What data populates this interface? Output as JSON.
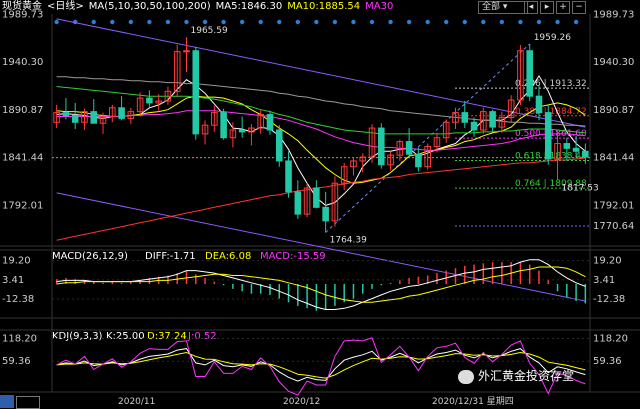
{
  "header": {
    "instrument": "现货黄金",
    "period": "<日线>",
    "ma_params": "MA(5,10,30,50,100,200)",
    "ma5": "MA5:1846.30",
    "ma10": "MA10:1885.54",
    "ma30": "MA30",
    "dropdown": "全部",
    "colors": {
      "ma5": "#ffffff",
      "ma10": "#ffff00",
      "ma30": "#ff33ff"
    }
  },
  "chart_data": [
    {
      "type": "candlestick",
      "ylim": [
        1750,
        1990
      ],
      "y_ticks": [
        "1989.73",
        "1940.30",
        "1890.87",
        "1841.44",
        "1792.01"
      ],
      "y_ticks_right": [
        "1989.73",
        "1940.30",
        "1890.87",
        "1841.44",
        "1792.01"
      ],
      "x_labels": [
        "2020/11",
        "2020/12",
        "2020/12/31 星期四"
      ],
      "current_price_line": 1841.44,
      "candles": [
        [
          1878,
          1896,
          1872,
          1888
        ],
        [
          1888,
          1903,
          1881,
          1885
        ],
        [
          1885,
          1898,
          1871,
          1878
        ],
        [
          1878,
          1892,
          1870,
          1889
        ],
        [
          1889,
          1902,
          1880,
          1877
        ],
        [
          1877,
          1888,
          1866,
          1884
        ],
        [
          1884,
          1896,
          1878,
          1893
        ],
        [
          1893,
          1905,
          1880,
          1882
        ],
        [
          1882,
          1893,
          1876,
          1889
        ],
        [
          1889,
          1909,
          1884,
          1903
        ],
        [
          1903,
          1911,
          1894,
          1898
        ],
        [
          1898,
          1907,
          1890,
          1900
        ],
        [
          1900,
          1915,
          1896,
          1910
        ],
        [
          1910,
          1958,
          1904,
          1951
        ],
        [
          1951,
          1966,
          1930,
          1952
        ],
        [
          1952,
          1956,
          1860,
          1866
        ],
        [
          1866,
          1880,
          1855,
          1875
        ],
        [
          1875,
          1895,
          1868,
          1888
        ],
        [
          1888,
          1892,
          1860,
          1862
        ],
        [
          1862,
          1878,
          1852,
          1870
        ],
        [
          1870,
          1884,
          1862,
          1868
        ],
        [
          1868,
          1876,
          1854,
          1872
        ],
        [
          1872,
          1891,
          1866,
          1886
        ],
        [
          1886,
          1890,
          1865,
          1870
        ],
        [
          1870,
          1875,
          1832,
          1838
        ],
        [
          1838,
          1848,
          1800,
          1806
        ],
        [
          1806,
          1818,
          1778,
          1783
        ],
        [
          1783,
          1815,
          1780,
          1810
        ],
        [
          1810,
          1818,
          1789,
          1790
        ],
        [
          1790,
          1806,
          1764,
          1776
        ],
        [
          1776,
          1822,
          1770,
          1815
        ],
        [
          1815,
          1836,
          1808,
          1832
        ],
        [
          1832,
          1842,
          1823,
          1838
        ],
        [
          1838,
          1846,
          1826,
          1842
        ],
        [
          1842,
          1876,
          1836,
          1872
        ],
        [
          1872,
          1877,
          1830,
          1834
        ],
        [
          1834,
          1848,
          1828,
          1844
        ],
        [
          1844,
          1860,
          1838,
          1858
        ],
        [
          1858,
          1872,
          1841,
          1845
        ],
        [
          1845,
          1852,
          1827,
          1832
        ],
        [
          1832,
          1856,
          1829,
          1853
        ],
        [
          1853,
          1867,
          1847,
          1862
        ],
        [
          1862,
          1881,
          1857,
          1878
        ],
        [
          1878,
          1893,
          1871,
          1888
        ],
        [
          1888,
          1900,
          1872,
          1878
        ],
        [
          1878,
          1883,
          1863,
          1870
        ],
        [
          1870,
          1893,
          1866,
          1889
        ],
        [
          1889,
          1891,
          1868,
          1873
        ],
        [
          1873,
          1889,
          1867,
          1883
        ],
        [
          1883,
          1906,
          1878,
          1901
        ],
        [
          1901,
          1958,
          1896,
          1952
        ],
        [
          1952,
          1959,
          1900,
          1905
        ],
        [
          1905,
          1916,
          1880,
          1888
        ],
        [
          1888,
          1896,
          1834,
          1840
        ],
        [
          1840,
          1870,
          1818,
          1856
        ],
        [
          1856,
          1862,
          1838,
          1851
        ],
        [
          1851,
          1864,
          1841,
          1848
        ],
        [
          1848,
          1856,
          1835,
          1842
        ]
      ],
      "ma_lines": [
        {
          "name": "MA5",
          "color": "#ffffff",
          "values": [
            1886,
            1887,
            1886,
            1885,
            1883,
            1882,
            1884,
            1884,
            1885,
            1886,
            1893,
            1896,
            1901,
            1912,
            1922,
            1916,
            1908,
            1897,
            1886,
            1872,
            1871,
            1868,
            1873,
            1871,
            1864,
            1850,
            1831,
            1815,
            1800,
            1792,
            1795,
            1804,
            1814,
            1832,
            1842,
            1848,
            1848,
            1850,
            1851,
            1843,
            1846,
            1850,
            1853,
            1856,
            1865,
            1871,
            1880,
            1880,
            1880,
            1886,
            1901,
            1911,
            1926,
            1910,
            1888,
            1868,
            1856,
            1848
          ]
        },
        {
          "name": "MA10",
          "color": "#ffff00",
          "values": [
            1890,
            1889,
            1889,
            1888,
            1886,
            1885,
            1884,
            1884,
            1885,
            1886,
            1888,
            1889,
            1891,
            1897,
            1903,
            1905,
            1904,
            1904,
            1903,
            1900,
            1897,
            1891,
            1886,
            1879,
            1872,
            1866,
            1859,
            1849,
            1840,
            1831,
            1824,
            1818,
            1815,
            1816,
            1818,
            1820,
            1826,
            1834,
            1843,
            1845,
            1848,
            1849,
            1852,
            1854,
            1858,
            1860,
            1864,
            1867,
            1869,
            1873,
            1882,
            1888,
            1894,
            1896,
            1898,
            1896,
            1892,
            1885
          ]
        },
        {
          "name": "MA30",
          "color": "#ff33ff",
          "values": [
            1884,
            1884,
            1884,
            1884,
            1884,
            1884,
            1884,
            1884,
            1885,
            1885,
            1886,
            1886,
            1887,
            1888,
            1890,
            1890,
            1890,
            1890,
            1889,
            1888,
            1887,
            1886,
            1885,
            1884,
            1882,
            1880,
            1877,
            1874,
            1871,
            1867,
            1863,
            1860,
            1857,
            1855,
            1853,
            1852,
            1852,
            1851,
            1851,
            1850,
            1849,
            1849,
            1850,
            1851,
            1852,
            1853,
            1854,
            1855,
            1856,
            1858,
            1861,
            1863,
            1865,
            1866,
            1866,
            1866,
            1865,
            1864
          ]
        },
        {
          "name": "MA50",
          "color": "#33cc33",
          "values": [
            1915,
            1914,
            1913,
            1912,
            1911,
            1910,
            1909,
            1908,
            1907,
            1906,
            1905,
            1905,
            1905,
            1905,
            1905,
            1904,
            1903,
            1902,
            1900,
            1898,
            1896,
            1894,
            1891,
            1889,
            1886,
            1884,
            1881,
            1878,
            1876,
            1874,
            1872,
            1870,
            1869,
            1868,
            1867,
            1866,
            1866,
            1866,
            1866,
            1866,
            1866,
            1866,
            1866,
            1867,
            1867,
            1867,
            1868,
            1868,
            1869,
            1869,
            1870,
            1871,
            1871,
            1871,
            1870,
            1869,
            1868,
            1867
          ]
        },
        {
          "name": "MA100",
          "color": "#999999",
          "values": [
            1925,
            1925,
            1924,
            1924,
            1923,
            1923,
            1922,
            1922,
            1921,
            1921,
            1920,
            1920,
            1919,
            1919,
            1918,
            1918,
            1917,
            1916,
            1915,
            1914,
            1913,
            1912,
            1911,
            1910,
            1908,
            1907,
            1905,
            1904,
            1902,
            1900,
            1899,
            1897,
            1896,
            1894,
            1893,
            1892,
            1890,
            1889,
            1888,
            1887,
            1886,
            1885,
            1884,
            1883,
            1882,
            1881,
            1880,
            1880,
            1879,
            1878,
            1878,
            1877,
            1877,
            1876,
            1876,
            1875,
            1875,
            1874
          ]
        },
        {
          "name": "MA200",
          "color": "#ff3333",
          "values": [
            1756,
            1758,
            1760,
            1762,
            1764,
            1766,
            1768,
            1770,
            1772,
            1774,
            1776,
            1778,
            1780,
            1782,
            1784,
            1786,
            1788,
            1790,
            1792,
            1794,
            1796,
            1798,
            1800,
            1802,
            1803,
            1805,
            1807,
            1808,
            1810,
            1811,
            1813,
            1814,
            1816,
            1817,
            1819,
            1820,
            1821,
            1822,
            1824,
            1825,
            1826,
            1827,
            1828,
            1829,
            1830,
            1831,
            1832,
            1833,
            1834,
            1835,
            1836,
            1836,
            1837,
            1838,
            1839,
            1839,
            1840,
            1841
          ]
        }
      ],
      "price_labels": [
        {
          "text": "1965.59",
          "i": 14,
          "price": 1966
        },
        {
          "text": "1764.39",
          "i": 29,
          "price": 1764
        },
        {
          "text": "1959.26",
          "i": 51,
          "price": 1959
        },
        {
          "text": "1817.53",
          "i": 54,
          "price": 1818
        }
      ],
      "fib_levels": [
        {
          "label": "0.236 | 1913.32",
          "price": 1913.32,
          "color": "#cccccc"
        },
        {
          "label": "0.382 | 1884.72",
          "price": 1884.72,
          "color": "#ff3333"
        },
        {
          "label": "0.500 | 1861.60",
          "price": 1861.6,
          "color": "#ff33ff"
        },
        {
          "label": "0.618 | 1838.48",
          "price": 1838.48,
          "color": "#33cc33"
        },
        {
          "label": "0.764 | 1809.88",
          "price": 1809.88,
          "color": "#33cc33"
        }
      ],
      "fib_extra_right": [
        "1770.64"
      ],
      "channel_upper": {
        "from": [
          0,
          1985
        ],
        "to": [
          57,
          1873
        ]
      },
      "channel_lower": {
        "from": [
          0,
          1805
        ],
        "to": [
          57,
          1693
        ]
      },
      "diag_line": {
        "from": [
          29,
          1764
        ],
        "to": [
          51,
          1959
        ]
      }
    },
    {
      "type": "bar",
      "name": "MACD",
      "label": "MACD(26,12,9)",
      "diff": "DIFF:-1.71",
      "dea": "DEA:6.08",
      "macd": "MACD:-15.59",
      "ylim": [
        -28,
        28
      ],
      "y_ticks": [
        "19.20",
        "3.41",
        "-12.38"
      ],
      "y_ticks_right": [
        "19.20",
        "3.41",
        "-12.38"
      ],
      "bars": [
        4,
        5,
        4,
        3,
        2,
        1,
        2,
        1,
        2,
        3,
        5,
        6,
        7,
        9,
        11,
        8,
        5,
        2,
        -1,
        -4,
        -6,
        -8,
        -8,
        -9,
        -12,
        -15,
        -18,
        -20,
        -22,
        -21,
        -18,
        -15,
        -12,
        -8,
        -4,
        -1,
        1,
        3,
        5,
        6,
        7,
        9,
        11,
        13,
        15,
        16,
        17,
        18,
        18,
        18,
        18,
        16,
        11,
        3,
        -6,
        -11,
        -14,
        -16
      ],
      "diff_line": [
        2,
        3,
        3,
        3,
        2,
        2,
        2,
        2,
        2,
        3,
        4,
        5,
        6,
        8,
        11,
        11,
        10,
        9,
        7,
        5,
        3,
        1,
        -1,
        -3,
        -6,
        -9,
        -13,
        -16,
        -19,
        -21,
        -21,
        -20,
        -18,
        -15,
        -12,
        -9,
        -6,
        -4,
        -2,
        -1,
        1,
        3,
        5,
        7,
        9,
        10,
        12,
        13,
        14,
        15,
        18,
        20,
        20,
        16,
        10,
        5,
        1,
        -2
      ],
      "dea_line": [
        0,
        1,
        1,
        2,
        2,
        2,
        2,
        2,
        2,
        2,
        2,
        3,
        3,
        4,
        5,
        6,
        7,
        8,
        8,
        7,
        7,
        6,
        5,
        4,
        3,
        1,
        -1,
        -3,
        -6,
        -9,
        -11,
        -13,
        -14,
        -15,
        -15,
        -14,
        -13,
        -12,
        -10,
        -9,
        -7,
        -5,
        -3,
        -1,
        1,
        3,
        4,
        6,
        7,
        9,
        11,
        12,
        14,
        14,
        14,
        13,
        10,
        6
      ]
    },
    {
      "type": "line",
      "name": "KDJ",
      "label": "KDJ(9,3,3)",
      "k": "K:25.00",
      "d": "D:37.24",
      "j": "J:0.52",
      "ylim": [
        -20,
        140
      ],
      "y_ticks": [
        "118.20",
        "59.36"
      ],
      "y_ticks_right": [
        "118.20",
        "59.36"
      ],
      "k_line": [
        50,
        55,
        52,
        60,
        48,
        52,
        58,
        50,
        55,
        65,
        72,
        75,
        78,
        88,
        92,
        55,
        50,
        62,
        48,
        45,
        50,
        46,
        58,
        50,
        32,
        18,
        8,
        18,
        12,
        10,
        40,
        62,
        70,
        76,
        85,
        62,
        70,
        80,
        70,
        55,
        68,
        78,
        82,
        88,
        75,
        68,
        78,
        68,
        75,
        85,
        92,
        70,
        55,
        30,
        45,
        40,
        32,
        25
      ],
      "d_line": [
        50,
        52,
        52,
        55,
        53,
        52,
        55,
        53,
        54,
        58,
        63,
        68,
        72,
        77,
        82,
        72,
        65,
        64,
        58,
        53,
        52,
        50,
        53,
        52,
        45,
        36,
        26,
        23,
        19,
        16,
        24,
        37,
        48,
        58,
        67,
        65,
        67,
        71,
        70,
        65,
        66,
        70,
        74,
        79,
        78,
        75,
        76,
        73,
        74,
        77,
        82,
        78,
        70,
        57,
        53,
        49,
        43,
        37
      ],
      "j_line": [
        50,
        62,
        52,
        72,
        38,
        52,
        66,
        44,
        58,
        80,
        92,
        90,
        90,
        110,
        112,
        20,
        20,
        58,
        28,
        28,
        46,
        38,
        68,
        46,
        6,
        -18,
        -28,
        8,
        -2,
        -2,
        72,
        112,
        114,
        112,
        120,
        56,
        76,
        98,
        70,
        35,
        72,
        94,
        98,
        106,
        69,
        54,
        82,
        58,
        77,
        101,
        112,
        54,
        25,
        -24,
        29,
        22,
        10,
        1
      ]
    }
  ],
  "watermark": "外汇黄金投资存堂"
}
